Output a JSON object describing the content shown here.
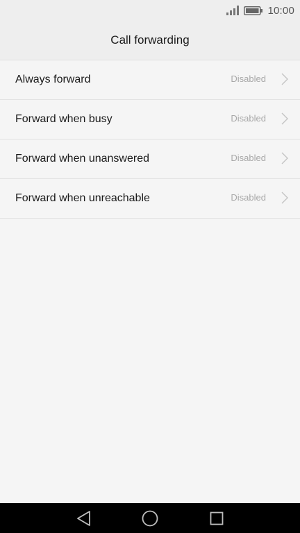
{
  "status_bar": {
    "time": "10:00",
    "signal_icon": "signal-icon",
    "battery_icon": "battery-icon"
  },
  "header": {
    "title": "Call forwarding"
  },
  "settings": [
    {
      "label": "Always forward",
      "value": "Disabled"
    },
    {
      "label": "Forward when busy",
      "value": "Disabled"
    },
    {
      "label": "Forward when unanswered",
      "value": "Disabled"
    },
    {
      "label": "Forward when unreachable",
      "value": "Disabled"
    }
  ],
  "nav_bar": {
    "back_icon": "back-triangle-icon",
    "home_icon": "home-circle-icon",
    "recents_icon": "recents-square-icon"
  },
  "colors": {
    "background": "#f5f5f5",
    "header_background": "#eeeeee",
    "divider": "#e2e2e2",
    "primary_text": "#1a1a1a",
    "secondary_text": "#a8a8a8",
    "nav_bar": "#000000"
  }
}
